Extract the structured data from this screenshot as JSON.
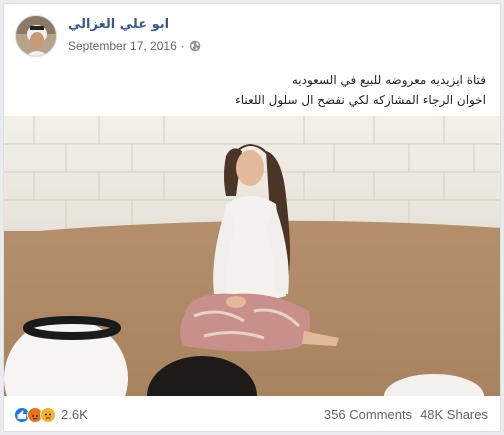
{
  "post": {
    "author": "ابو علي الغزالي",
    "date": "September 17, 2016",
    "separator": "·",
    "privacy_icon": "globe-icon",
    "caption_lines": [
      "فتاة ايزيديه معروضه للبيع في السعوديه",
      "اخوان الرجاء المشاركه لكي نفضح ال سلول اللعناء"
    ]
  },
  "footer": {
    "reaction_icons": [
      "like-icon",
      "angry-icon",
      "sad-icon"
    ],
    "reaction_count": "2.6K",
    "comments": "356 Comments",
    "shares": "48K Shares"
  },
  "colors": {
    "link": "#385898",
    "like": "#1877f2",
    "angry": "#e9710f",
    "sad": "#f7b125"
  }
}
